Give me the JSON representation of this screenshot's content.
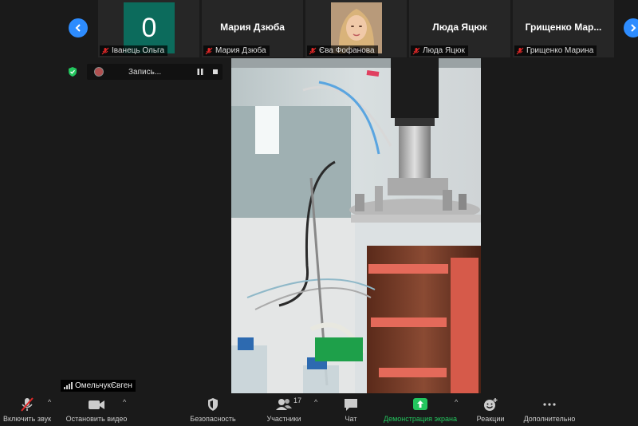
{
  "participants": [
    {
      "display": "0",
      "label": "Іванець Ольга"
    },
    {
      "display": "Мария Дзюба",
      "label": "Мария Дзюба"
    },
    {
      "display": "",
      "label": "Єва Фофанова"
    },
    {
      "display": "Люда Яцюк",
      "label": "Люда Яцюк"
    },
    {
      "display": "Грищенко  Мар...",
      "label": "Грищенко Марина"
    }
  ],
  "recording": {
    "label": "Запись..."
  },
  "active_speaker": {
    "name": "ОмельчукЄвген"
  },
  "toolbar": {
    "unmute": "Включить звук",
    "stop_video": "Остановить видео",
    "security": "Безопасность",
    "participants": "Участники",
    "participants_count": "17",
    "chat": "Чат",
    "share_screen": "Демонстрация экрана",
    "reactions": "Реакции",
    "more": "Дополнительно"
  },
  "colors": {
    "accent": "#2d8cff",
    "share": "#23c55e",
    "avatar_bg": "#0c6b5c",
    "mute_red": "#e02828"
  }
}
